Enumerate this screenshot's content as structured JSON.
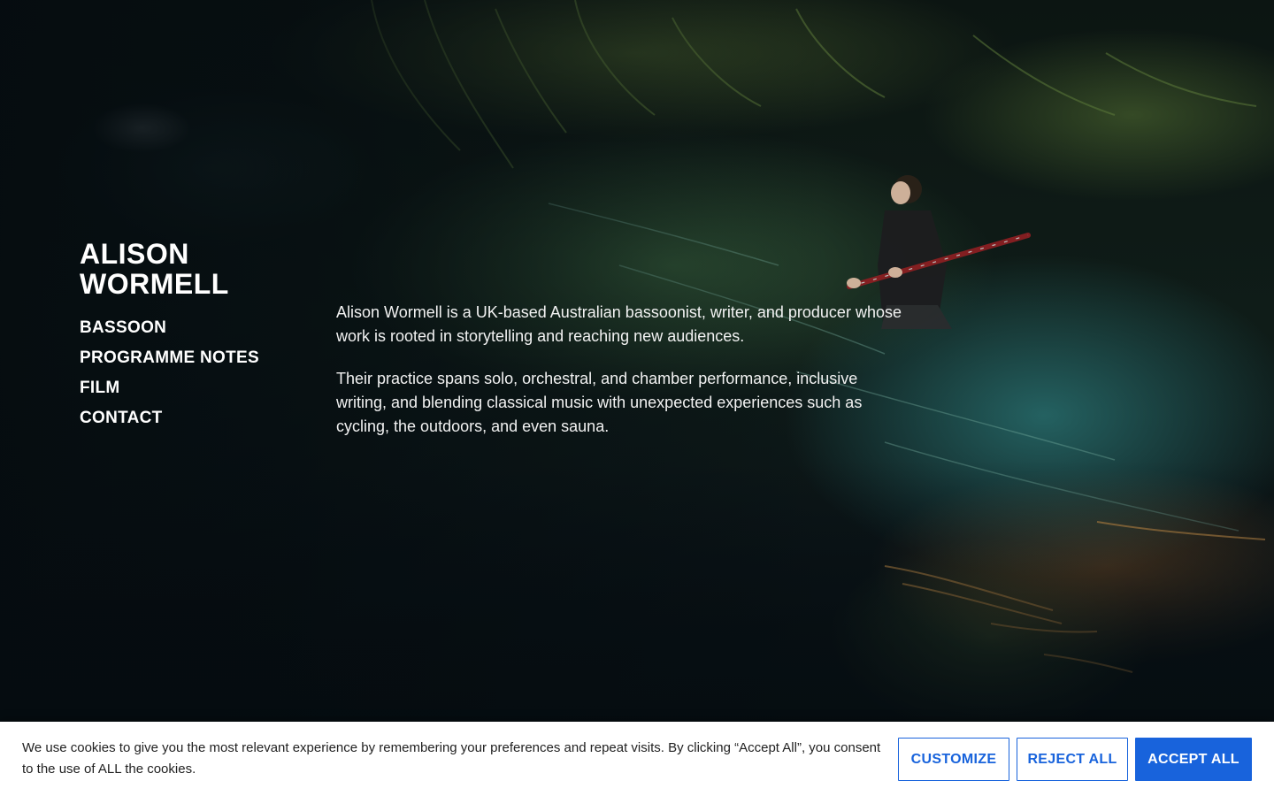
{
  "site": {
    "name": "ALISON WORMELL"
  },
  "nav": {
    "items": [
      {
        "label": "BASSOON"
      },
      {
        "label": "PROGRAMME NOTES"
      },
      {
        "label": "FILM"
      },
      {
        "label": "CONTACT"
      }
    ]
  },
  "intro": {
    "paragraph_1": "Alison Wormell is a UK-based Australian bassoonist, writer, and producer whose work is rooted in storytelling and reaching new audiences.",
    "paragraph_2": "Their practice spans solo, orchestral, and chamber performance, inclusive writing, and blending classical music with unexpected experiences such as cycling, the outdoors, and even sauna."
  },
  "hero_image": {
    "subject": "bassoonist-standing-in-river"
  },
  "cookie_banner": {
    "message": "We use cookies to give you the most relevant experience by remembering your preferences and repeat visits. By clicking “Accept All”, you consent to the use of ALL the cookies.",
    "customize_label": "CUSTOMIZE",
    "reject_label": "REJECT ALL",
    "accept_label": "ACCEPT ALL",
    "accent_color": "#1863dc"
  }
}
